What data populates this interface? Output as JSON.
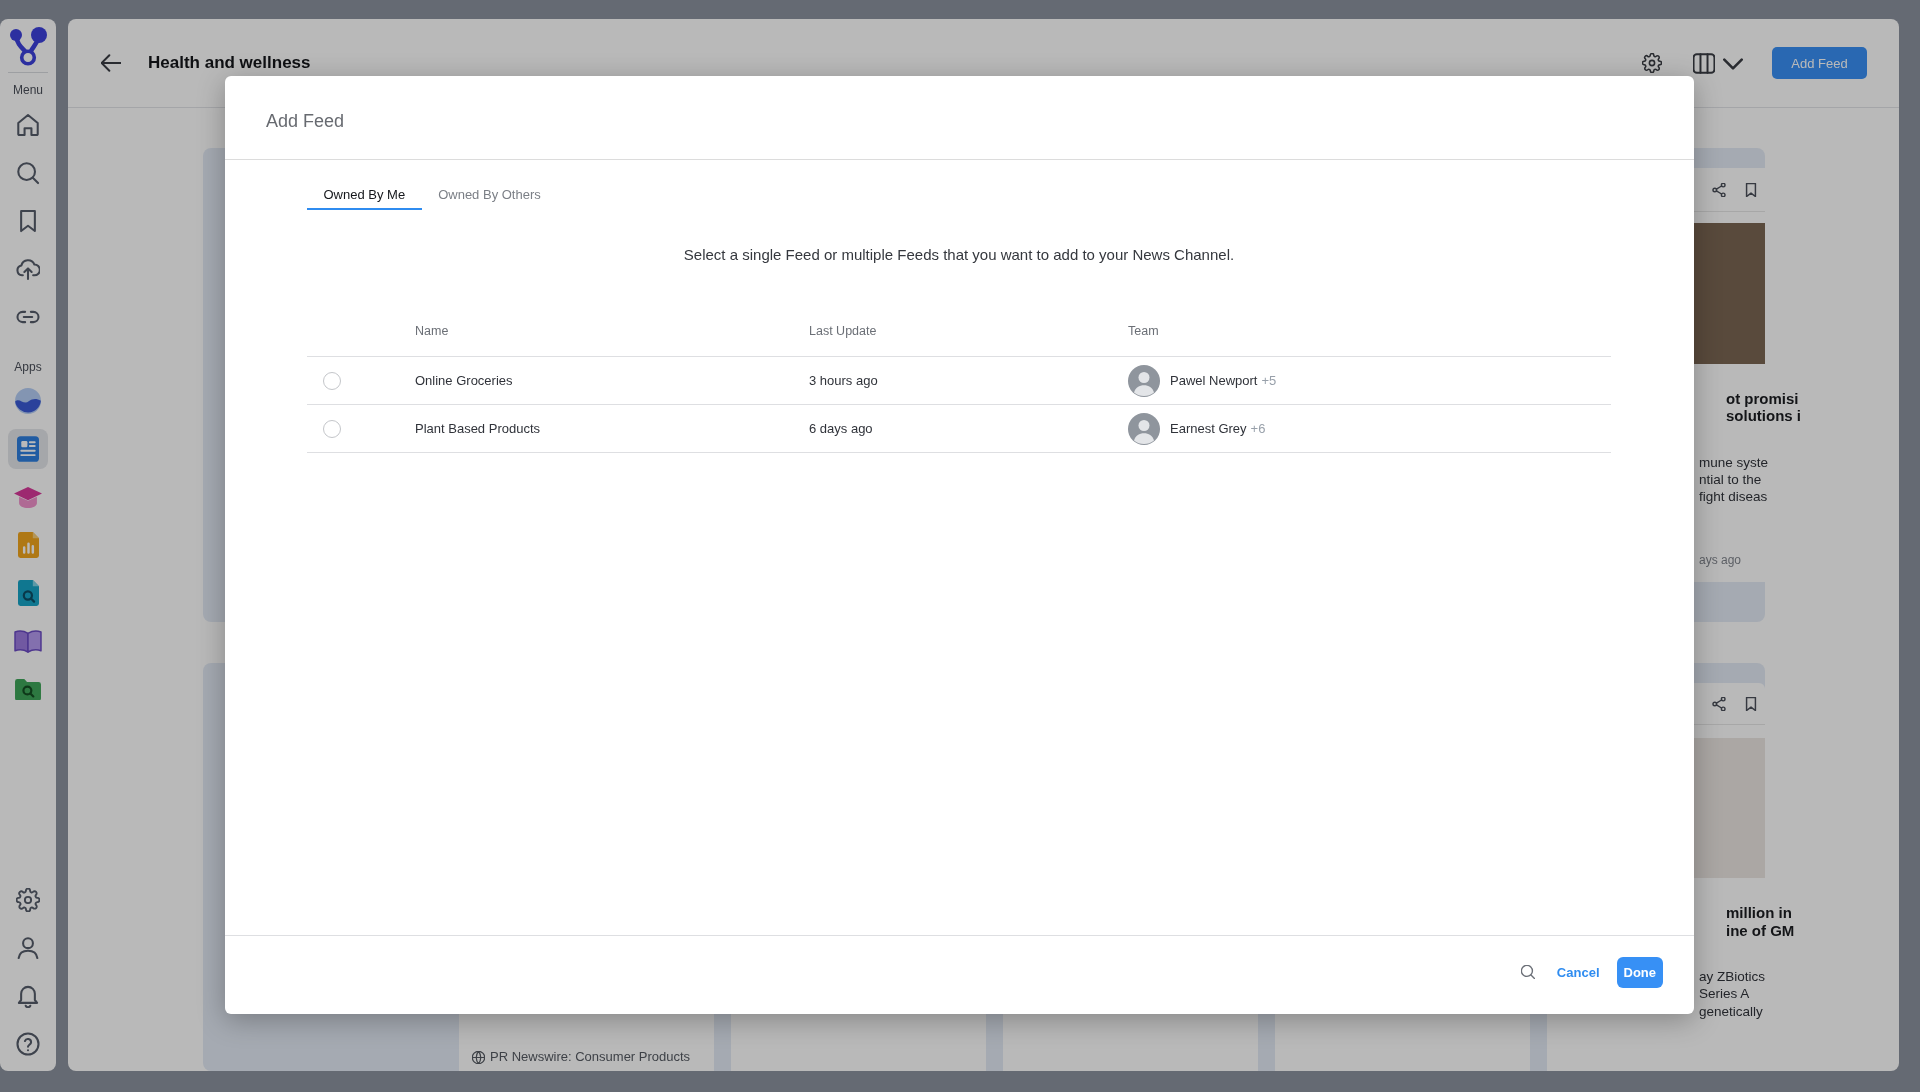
{
  "sidebar": {
    "menu_label": "Menu",
    "apps_label": "Apps",
    "apps": [
      {
        "selected": false
      },
      {
        "selected": true
      },
      {
        "selected": false
      },
      {
        "selected": false
      },
      {
        "selected": false
      },
      {
        "selected": false
      },
      {
        "selected": false
      }
    ]
  },
  "header": {
    "title": "Health and wellness",
    "add_button": "Add Feed"
  },
  "feed_grid": {
    "cards": [
      {
        "title_lines": [
          "ot promisi",
          "solutions i"
        ],
        "description_lines": [
          "mune syste",
          "ntial to the",
          "fight diseas"
        ],
        "time": "ays ago"
      },
      {
        "title_lines": [
          "million in",
          "ine of GM"
        ],
        "description_lines": [
          "ay ZBiotics",
          "Series A",
          "genetically"
        ]
      }
    ],
    "source": "PR Newswire: Consumer Products"
  },
  "dialog": {
    "title": "Add Feed",
    "tabs": [
      {
        "label": "Owned By Me",
        "selected": true
      },
      {
        "label": "Owned By Others",
        "selected": false
      }
    ],
    "instruction": "Select a single Feed or multiple Feeds that you want to add to your News Channel.",
    "columns": [
      "Name",
      "Last Update",
      "Team"
    ],
    "rows": [
      {
        "selected": false,
        "name": "Online Groceries",
        "last_update": "3 hours ago",
        "team": {
          "member": "Pawel Newport",
          "more": "+5"
        }
      },
      {
        "selected": false,
        "name": "Plant Based Products",
        "last_update": "6 days ago",
        "team": {
          "member": "Earnest Grey",
          "more": "+6"
        }
      }
    ],
    "cancel": "Cancel",
    "done": "Done"
  }
}
